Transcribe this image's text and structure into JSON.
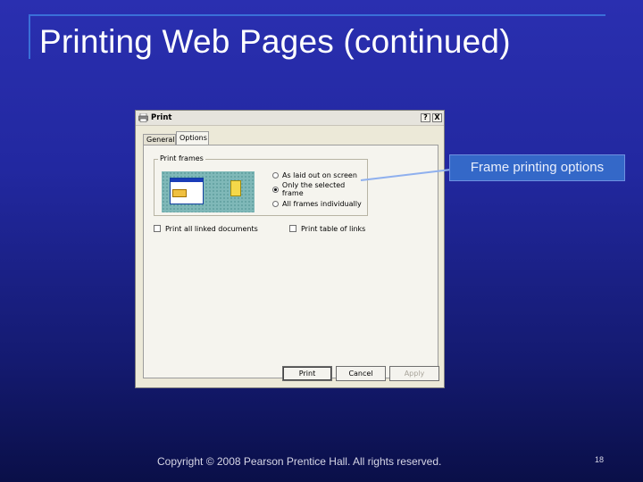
{
  "slide": {
    "title": "Printing Web Pages (continued)",
    "footer": "Copyright © 2008 Pearson Prentice Hall. All rights reserved.",
    "page_number": "18"
  },
  "dialog": {
    "title": "Print",
    "title_icon": "printer-icon",
    "help_button": "?",
    "close_button": "X",
    "tabs": [
      {
        "label": "General",
        "active": false
      },
      {
        "label": "Options",
        "active": true
      }
    ],
    "print_frames": {
      "legend": "Print frames",
      "options": [
        {
          "label": "As laid out on screen",
          "checked": false
        },
        {
          "label": "Only the selected frame",
          "checked": true
        },
        {
          "label": "All frames individually",
          "checked": false
        }
      ]
    },
    "checkboxes": [
      {
        "label": "Print all linked documents",
        "checked": false
      },
      {
        "label": "Print table of links",
        "checked": false
      }
    ],
    "buttons": {
      "print": "Print",
      "cancel": "Cancel",
      "apply": "Apply"
    }
  },
  "callout": {
    "text": "Frame printing options"
  },
  "colors": {
    "background_top": "#2a2fb0",
    "background_bottom": "#0a0f48",
    "callout_fill": "#3468c8",
    "accent_line": "#3a6fd8"
  }
}
